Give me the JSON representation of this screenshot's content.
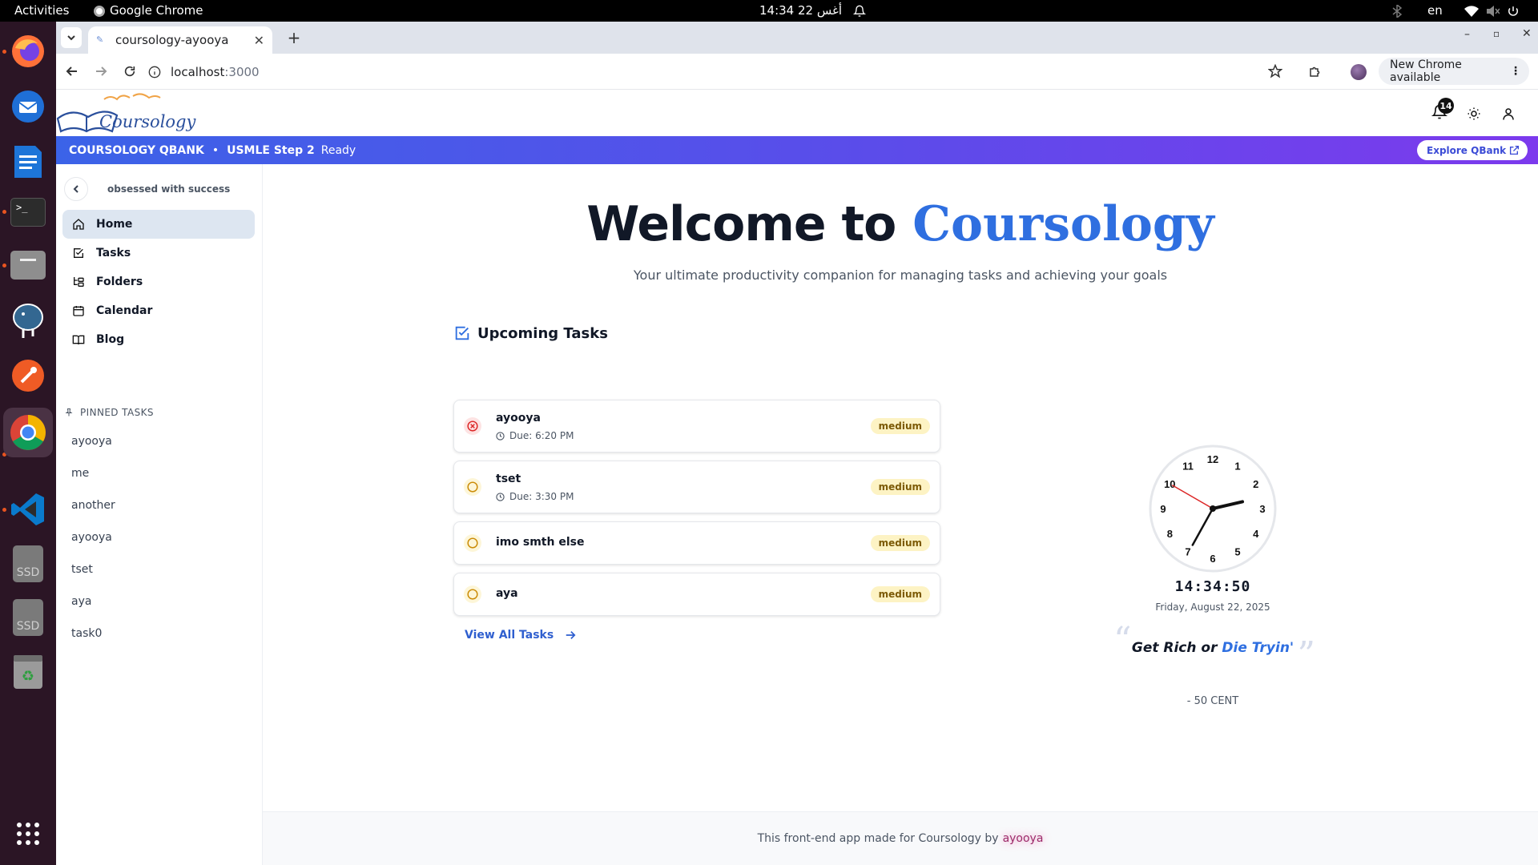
{
  "system": {
    "activities": "Activities",
    "app_name": "Google Chrome",
    "clock": "14:34  22 أغس",
    "language": "en"
  },
  "dock": {
    "apps": [
      "firefox-icon",
      "thunderbird-icon",
      "writer-icon",
      "terminal-icon",
      "files-icon",
      "postgres-icon",
      "postman-icon",
      "chrome-icon",
      "vscode-icon",
      "ssd-drive-icon",
      "ssd-drive-icon",
      "trash-icon",
      "show-apps-icon"
    ],
    "ssd_label": "SSD"
  },
  "browser": {
    "tab_title": "coursology-ayooya",
    "url_host": "localhost",
    "url_port": ":3000",
    "update_label": "New Chrome available"
  },
  "header": {
    "logo_text": "Coursology",
    "notification_count": "14"
  },
  "banner": {
    "brand": "COURSOLOGY QBANK",
    "separator": "•",
    "exam": "USMLE Step 2",
    "status": "Ready",
    "cta": "Explore QBank"
  },
  "sidebar": {
    "tagline": "obsessed with success",
    "nav": [
      {
        "label": "Home",
        "icon": "home-icon",
        "active": true
      },
      {
        "label": "Tasks",
        "icon": "check-square-icon",
        "active": false
      },
      {
        "label": "Folders",
        "icon": "folder-tree-icon",
        "active": false
      },
      {
        "label": "Calendar",
        "icon": "calendar-icon",
        "active": false
      },
      {
        "label": "Blog",
        "icon": "book-icon",
        "active": false
      }
    ],
    "pinned_heading": "PINNED TASKS",
    "pinned": [
      "ayooya",
      "me",
      "another",
      "ayooya",
      "tset",
      "aya",
      "task0"
    ]
  },
  "hero": {
    "title_prefix": "Welcome to",
    "title_brand": "Coursology",
    "subtitle": "Your ultimate productivity companion for managing tasks and achieving your goals"
  },
  "tasks": {
    "heading": "Upcoming Tasks",
    "items": [
      {
        "title": "ayooya",
        "due": "Due: 6:20 PM",
        "priority": "medium",
        "status": "overdue"
      },
      {
        "title": "tset",
        "due": "Due: 3:30 PM",
        "priority": "medium",
        "status": "pending"
      },
      {
        "title": "imo smth else",
        "due": "",
        "priority": "medium",
        "status": "pending"
      },
      {
        "title": "aya",
        "due": "",
        "priority": "medium",
        "status": "pending"
      }
    ],
    "view_all": "View All Tasks"
  },
  "clock": {
    "time": "14:34:50",
    "date": "Friday, August 22, 2025",
    "numbers": [
      "12",
      "1",
      "2",
      "3",
      "4",
      "5",
      "6",
      "7",
      "8",
      "9",
      "10",
      "11"
    ]
  },
  "quote": {
    "part1": "Get Rich",
    "connector": "or",
    "part2": "Die Tryin'",
    "author": "- 50 CENT"
  },
  "footer": {
    "text": "This front-end app made for Coursology by",
    "author": "ayooya"
  }
}
